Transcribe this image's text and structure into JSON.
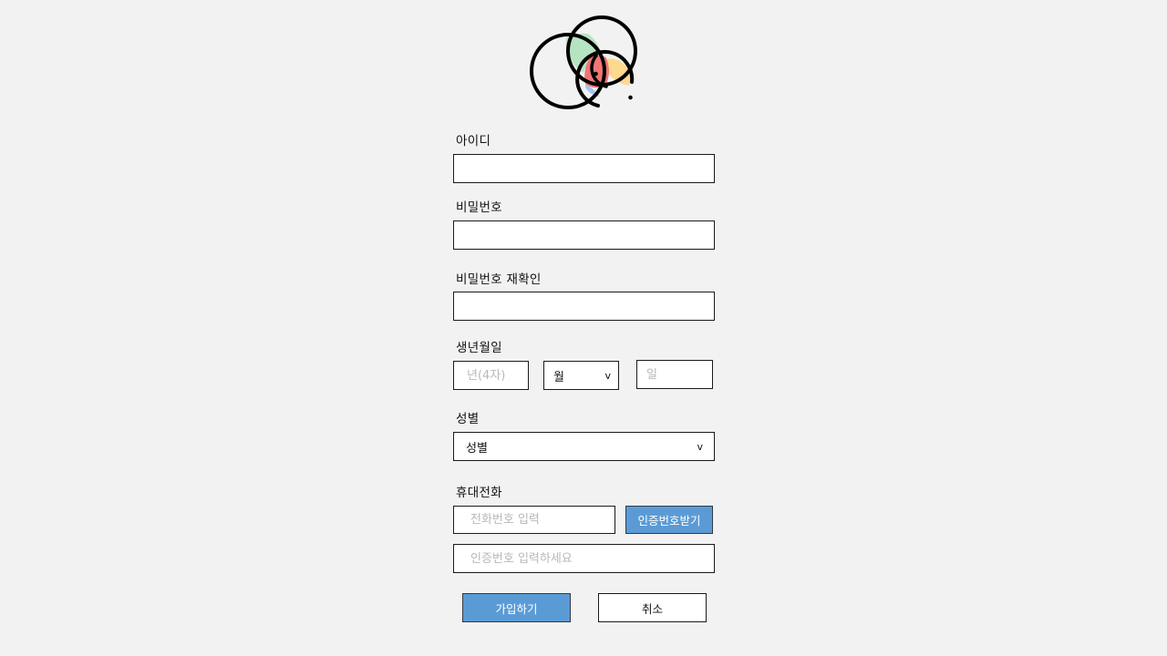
{
  "logo": {
    "icon": "venn-circles-logo"
  },
  "form": {
    "id": {
      "label": "아이디",
      "value": "",
      "placeholder": ""
    },
    "password": {
      "label": "비밀번호",
      "value": "",
      "placeholder": ""
    },
    "password_confirm": {
      "label": "비밀번호 재확인",
      "value": "",
      "placeholder": ""
    },
    "birth": {
      "label": "생년월일",
      "year_placeholder": "년(4자)",
      "month_selected": "월",
      "day_placeholder": "일"
    },
    "gender": {
      "label": "성별",
      "selected": "성별"
    },
    "phone": {
      "label": "휴대전화",
      "number_placeholder": "전화번호 입력",
      "request_code_label": "인증번호받기",
      "code_placeholder": "인증번호 입력하세요"
    }
  },
  "actions": {
    "submit_label": "가입하기",
    "cancel_label": "취소"
  },
  "colors": {
    "background": "#f2f2f2",
    "primary": "#5b9bd5",
    "logo_green": "#b7e4c0",
    "logo_yellow": "#fdd98e",
    "logo_red": "#f07575",
    "logo_blue": "#a9c4ef"
  }
}
